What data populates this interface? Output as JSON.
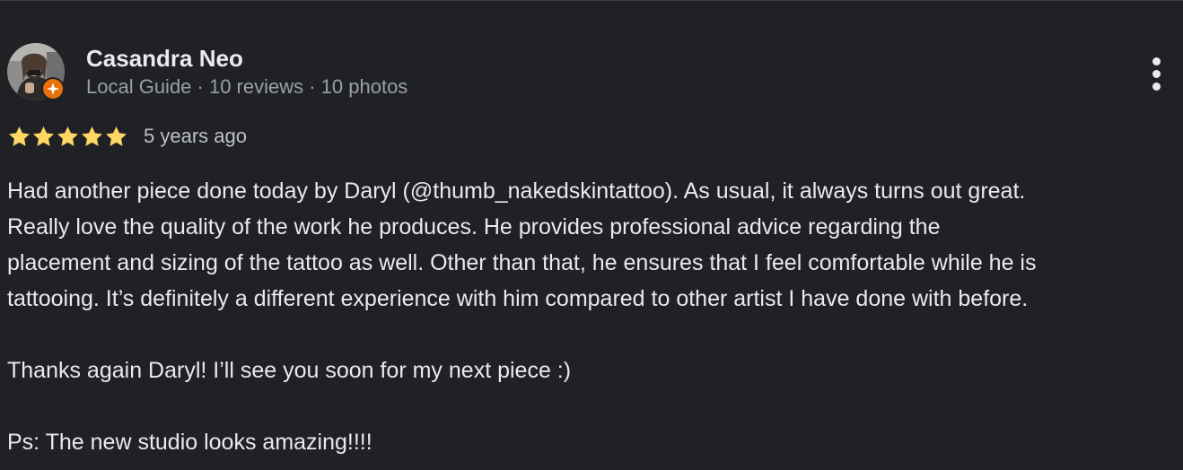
{
  "reviewer": {
    "name": "Casandra Neo",
    "meta": "Local Guide · 10 reviews · 10 photos",
    "avatar_icon": "reviewer-photo",
    "badge_icon": "local-guide-badge-icon",
    "badge_color": "#e8710a"
  },
  "menu": {
    "icon": "more-vert-icon"
  },
  "review": {
    "rating": 5,
    "rating_max": 5,
    "star_color": "#fdd663",
    "date": "5 years ago",
    "lines": [
      "Had another piece done today by Daryl (@thumb_nakedskintattoo). As usual, it always turns out great.",
      "Really love the quality of the work he produces. He provides professional advice regarding the",
      "placement and sizing of the tattoo as well. Other than that, he ensures that I feel comfortable while he is",
      "tattooing. It’s definitely a different experience with him compared to other artist I have done with before.",
      "",
      "Thanks again Daryl! I’ll see you soon for my next piece :)",
      "",
      "Ps: The new studio looks amazing!!!!"
    ]
  },
  "theme": {
    "background": "#202124",
    "text_primary": "#e8eaed",
    "text_secondary": "#9aa0a6"
  }
}
